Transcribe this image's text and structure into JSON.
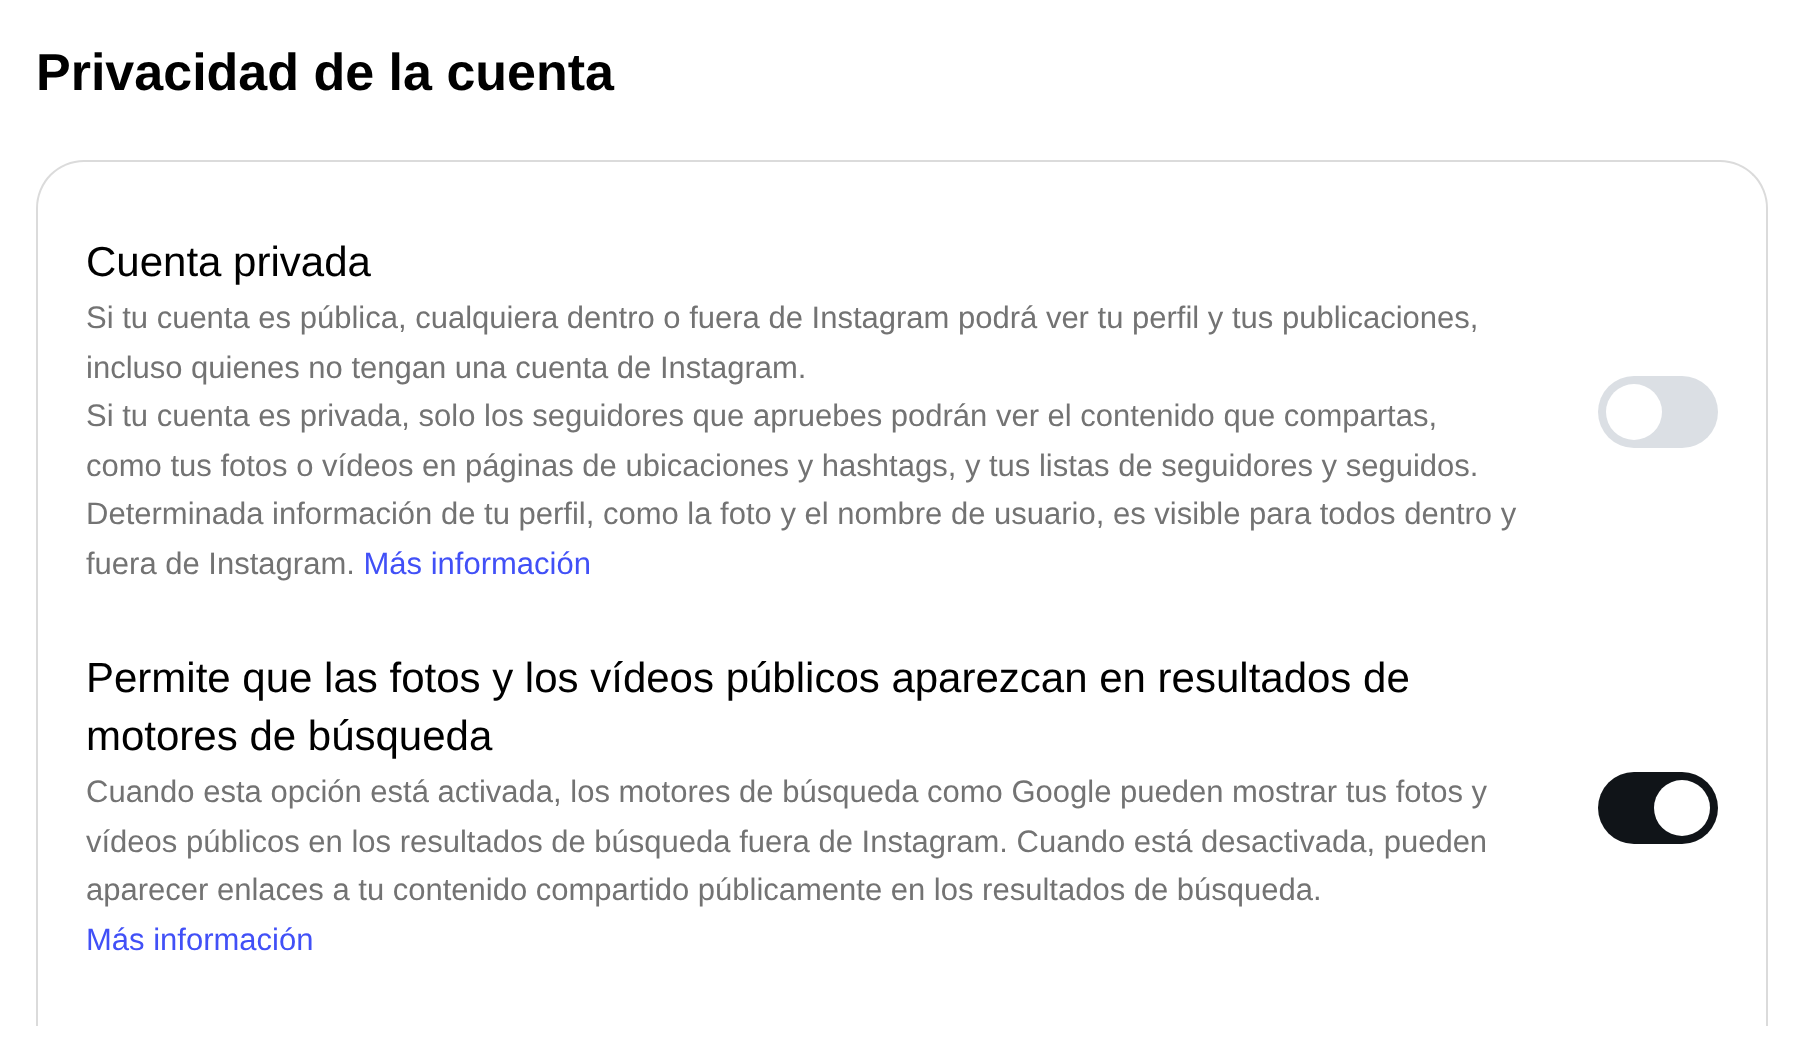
{
  "title": "Privacidad de la cuenta",
  "settings": [
    {
      "label": "Cuenta privada",
      "on": false,
      "description": [
        "Si tu cuenta es pública, cualquiera dentro o fuera de Instagram podrá ver tu perfil y tus publicaciones, incluso quienes no tengan una cuenta de Instagram.",
        "Si tu cuenta es privada, solo los seguidores que apruebes podrán ver el contenido que compartas, como tus fotos o vídeos en páginas de ubicaciones y hashtags, y tus listas de seguidores y seguidos. Determinada información de tu perfil, como la foto y el nombre de usuario, es visible para todos dentro y fuera de Instagram."
      ],
      "link": "Más información"
    },
    {
      "label": "Permite que las fotos y los vídeos públicos aparezcan en resultados de motores de búsqueda",
      "on": true,
      "description": [
        "Cuando esta opción está activada, los motores de búsqueda como Google pueden mostrar tus fotos y vídeos públicos en los resultados de búsqueda fuera de Instagram. Cuando está desactivada, pueden aparecer enlaces a tu contenido compartido públicamente en los resultados de búsqueda."
      ],
      "link": "Más información"
    }
  ]
}
